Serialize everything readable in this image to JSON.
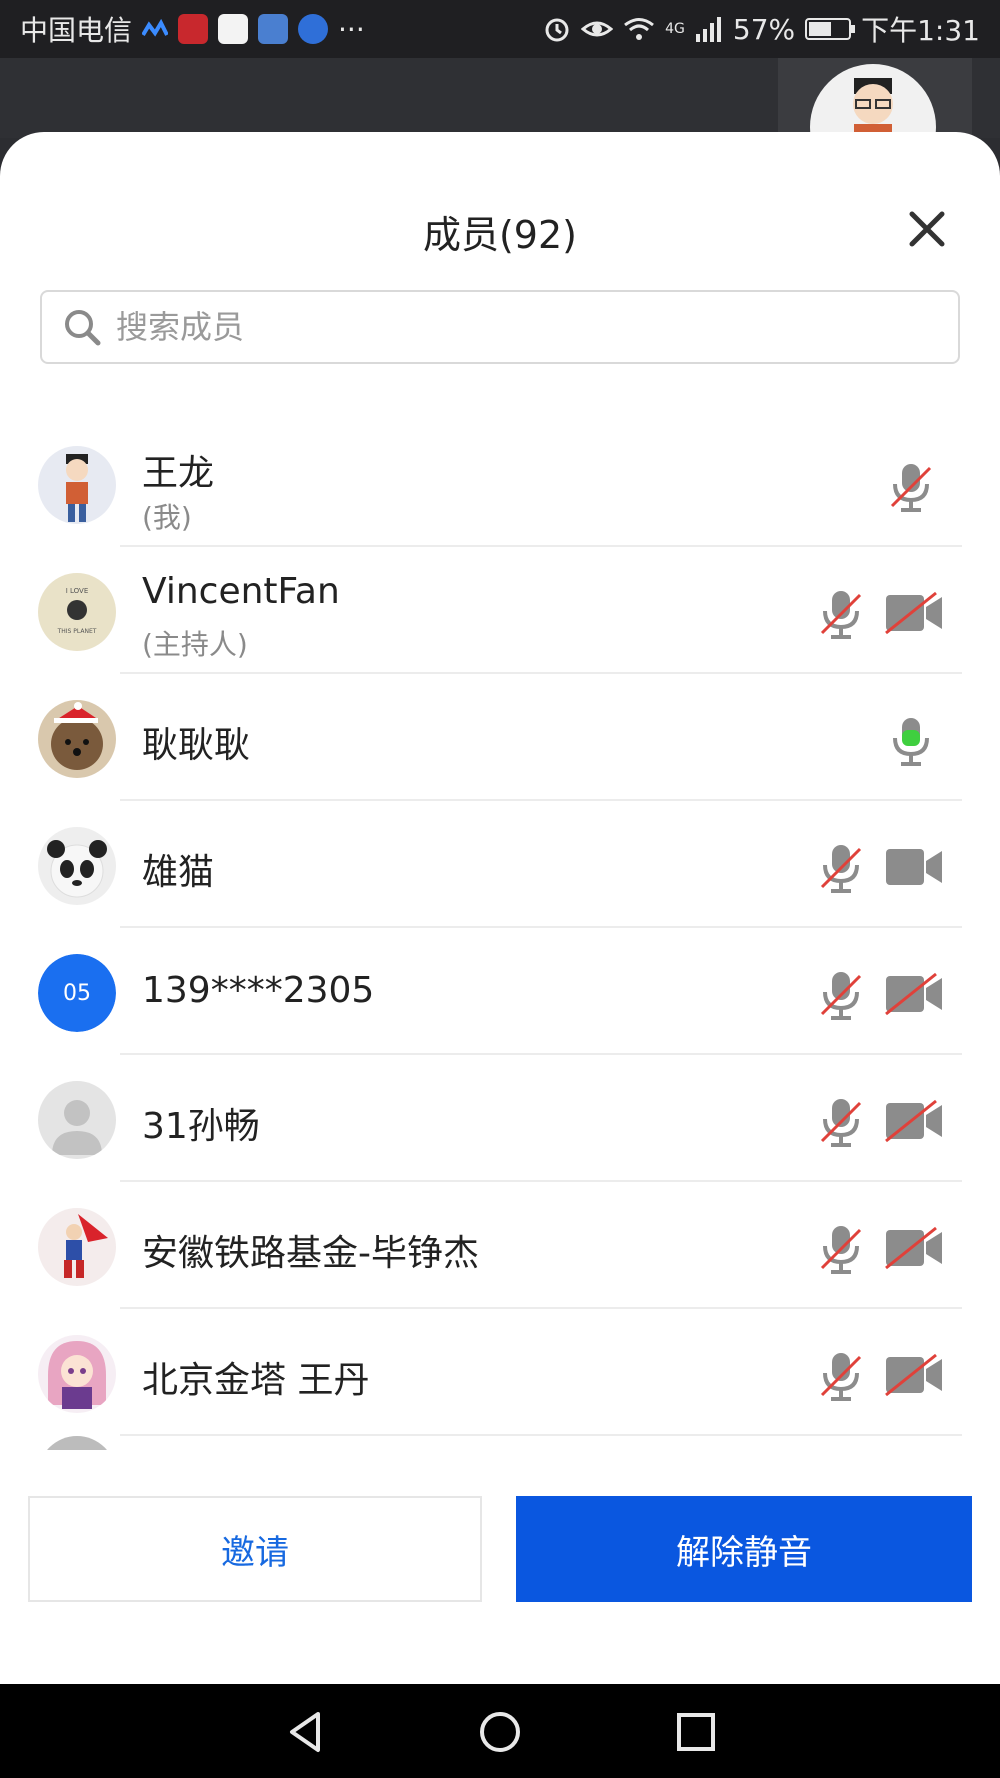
{
  "status_bar": {
    "carrier": "中国电信",
    "more": "···",
    "network": "4G",
    "battery": "57%",
    "time": "下午1:31"
  },
  "panel": {
    "title": "成员(92)",
    "search_placeholder": "搜索成员"
  },
  "members": [
    {
      "name": "王龙",
      "role": "(我)",
      "mic": "muted",
      "video": "none"
    },
    {
      "name": "VincentFan",
      "role": "(主持人)",
      "mic": "muted",
      "video": "off"
    },
    {
      "name": "耿耿耿",
      "role": "",
      "mic": "speaking",
      "video": "none"
    },
    {
      "name": "雄猫",
      "role": "",
      "mic": "muted",
      "video": "on"
    },
    {
      "name": "139****2305",
      "role": "",
      "mic": "muted",
      "video": "off",
      "avatar_text": "05",
      "avatar_color": "#1a6ff0"
    },
    {
      "name": "31孙畅",
      "role": "",
      "mic": "muted",
      "video": "off"
    },
    {
      "name": "安徽铁路基金-毕铮杰",
      "role": "",
      "mic": "muted",
      "video": "off"
    },
    {
      "name": "北京金塔 王丹",
      "role": "",
      "mic": "muted",
      "video": "off"
    }
  ],
  "buttons": {
    "invite": "邀请",
    "unmute": "解除静音"
  },
  "colors": {
    "primary": "#0a57e0",
    "link": "#1769e0",
    "speaking": "#3fcf3f",
    "muted_slash": "#e0413a",
    "icon_gray": "#8c8c8c"
  }
}
